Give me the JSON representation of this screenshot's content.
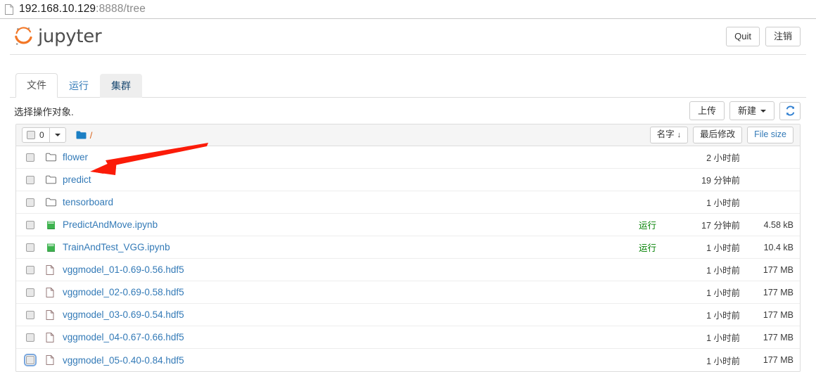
{
  "titlebar": {
    "icon": "page-document-icon",
    "host": "192.168.10.129",
    "path": ":8888/tree"
  },
  "header": {
    "logo_icon": "jupyter-logo-icon",
    "logo_text": "jupyter",
    "quit_label": "Quit",
    "logout_label": "注销"
  },
  "tabs": [
    {
      "label": "文件",
      "state": "active"
    },
    {
      "label": "运行",
      "state": "default"
    },
    {
      "label": "集群",
      "state": "hovered"
    }
  ],
  "toolbar": {
    "note": "选择操作对象.",
    "upload_label": "上传",
    "new_label": "新建",
    "new_caret_icon": "chevron-down-icon",
    "refresh_icon": "refresh-icon"
  },
  "list_header": {
    "select_all_checkbox": "unchecked",
    "selected_count": "0",
    "dropdown_caret_icon": "chevron-down-icon",
    "folder_icon": "folder-filled-icon",
    "breadcrumb": "/",
    "sort_name": "名字",
    "sort_name_arrow": "↓",
    "sort_modified": "最后修改",
    "sort_filesize": "File size"
  },
  "rows": [
    {
      "icon": "folder-outline-icon",
      "name": "flower",
      "running": "",
      "modified": "2 小时前",
      "size": "",
      "checkbox": "unchecked"
    },
    {
      "icon": "folder-outline-icon",
      "name": "predict",
      "running": "",
      "modified": "19 分钟前",
      "size": "",
      "checkbox": "unchecked"
    },
    {
      "icon": "folder-outline-icon",
      "name": "tensorboard",
      "running": "",
      "modified": "1 小时前",
      "size": "",
      "checkbox": "unchecked"
    },
    {
      "icon": "notebook-icon",
      "name": "PredictAndMove.ipynb",
      "running": "运行",
      "modified": "17 分钟前",
      "size": "4.58 kB",
      "checkbox": "unchecked"
    },
    {
      "icon": "notebook-icon",
      "name": "TrainAndTest_VGG.ipynb",
      "running": "运行",
      "modified": "1 小时前",
      "size": "10.4 kB",
      "checkbox": "unchecked"
    },
    {
      "icon": "file-icon",
      "name": "vggmodel_01-0.69-0.56.hdf5",
      "running": "",
      "modified": "1 小时前",
      "size": "177 MB",
      "checkbox": "unchecked"
    },
    {
      "icon": "file-icon",
      "name": "vggmodel_02-0.69-0.58.hdf5",
      "running": "",
      "modified": "1 小时前",
      "size": "177 MB",
      "checkbox": "unchecked"
    },
    {
      "icon": "file-icon",
      "name": "vggmodel_03-0.69-0.54.hdf5",
      "running": "",
      "modified": "1 小时前",
      "size": "177 MB",
      "checkbox": "unchecked"
    },
    {
      "icon": "file-icon",
      "name": "vggmodel_04-0.67-0.66.hdf5",
      "running": "",
      "modified": "1 小时前",
      "size": "177 MB",
      "checkbox": "unchecked"
    },
    {
      "icon": "file-icon",
      "name": "vggmodel_05-0.40-0.84.hdf5",
      "running": "",
      "modified": "1 小时前",
      "size": "177 MB",
      "checkbox": "focused"
    }
  ],
  "annotation": {
    "type": "red-arrow",
    "points_to": "predict",
    "color": "#fb1b08"
  },
  "colors": {
    "link": "#337ab7",
    "running_green": "#008000",
    "jupyter_orange": "#f37726",
    "annotation_red": "#fb1b08"
  }
}
